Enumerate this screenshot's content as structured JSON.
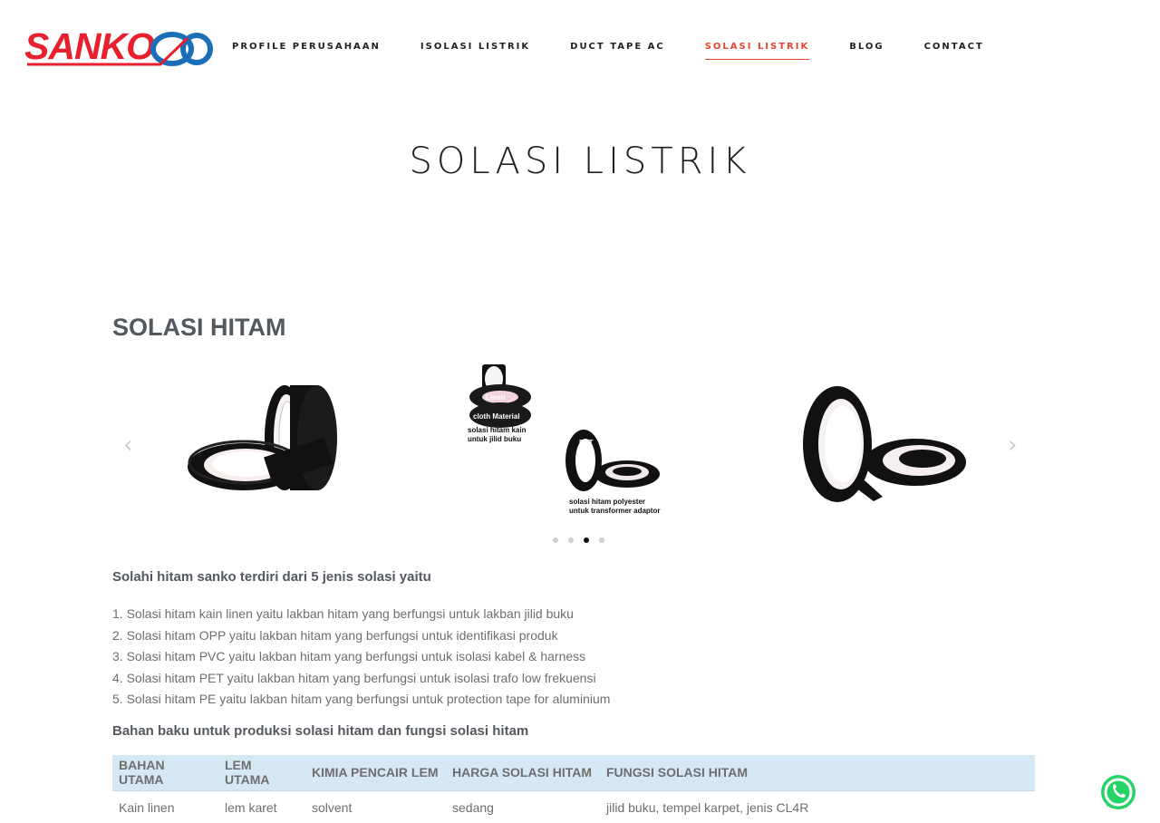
{
  "brand": {
    "logo_text": "SANKO"
  },
  "nav": {
    "items": [
      {
        "label": "PROFILE PERUSAHAAN",
        "active": false
      },
      {
        "label": "ISOLASI LISTRIK",
        "active": false
      },
      {
        "label": "DUCT TAPE AC",
        "active": false
      },
      {
        "label": "SOLASI LISTRIK",
        "active": true
      },
      {
        "label": "BLOG",
        "active": false
      },
      {
        "label": "CONTACT",
        "active": false
      }
    ],
    "active_color": "#e8432e"
  },
  "page": {
    "title": "SOLASI LISTRIK"
  },
  "section": {
    "title": "SOLASI HITAM"
  },
  "carousel": {
    "slides": [
      {
        "image": "black tape rolls"
      },
      {
        "image": "black tape product labels",
        "captions": [
          "Linen",
          "cloth Material",
          "solasi hitam kain",
          "untuk jilid buku",
          "PET",
          "solasi hitam polyester",
          "untuk transformer adaptor"
        ]
      },
      {
        "image": "black tape rolls"
      }
    ],
    "dots": 4,
    "active_dot": 3,
    "prev_icon": "chevron-left-icon",
    "next_icon": "chevron-right-icon"
  },
  "content": {
    "intro_heading": "Solahi hitam sanko terdiri dari 5 jenis solasi yaitu",
    "list": [
      "1. Solasi hitam kain linen yaitu lakban hitam yang berfungsi untuk lakban jilid buku",
      "2. Solasi hitam OPP yaitu lakban hitam yang berfungsi untuk identifikasi produk",
      "3. Solasi hitam PVC yaitu lakban hitam yang berfungsi untuk isolasi kabel & harness",
      "4. Solasi hitam PET yaitu lakban hitam yang berfungsi untuk isolasi trafo low frekuensi",
      "5. Solasi hitam PE yaitu lakban hitam yang berfungsi untuk protection tape for aluminium"
    ],
    "table_heading": "Bahan baku untuk produksi solasi hitam dan fungsi solasi hitam"
  },
  "table": {
    "headers": [
      "BAHAN UTAMA",
      "LEM UTAMA",
      "KIMIA PENCAIR LEM",
      "HARGA SOLASI HITAM",
      "FUNGSI SOLASI HITAM"
    ],
    "rows": [
      [
        "Kain linen",
        "lem karet",
        "solvent",
        "sedang",
        "jilid buku, tempel karpet, jenis CL4R"
      ]
    ],
    "header_bg": "#d7e8f5"
  },
  "floating": {
    "whatsapp_icon": "whatsapp-icon",
    "whatsapp_color": "#25d366"
  }
}
